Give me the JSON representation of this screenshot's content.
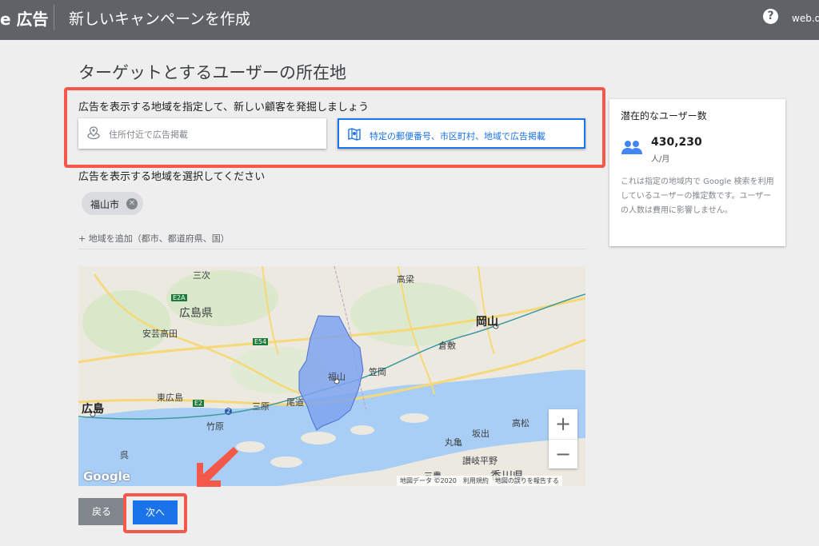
{
  "topbar": {
    "brand": "e 広告",
    "title": "新しいキャンペーンを作成",
    "help_icon": "?",
    "account": "web.de"
  },
  "page": {
    "heading": "ターゲットとするユーザーの所在地"
  },
  "location_type": {
    "label": "広告を表示する地域を指定して、新しい顧客を発掘しましょう",
    "options": [
      {
        "label": "住所付近で広告掲載",
        "icon": "location-radius-icon",
        "selected": false
      },
      {
        "label": "特定の郵便番号、市区町村、地域で広告掲載",
        "icon": "map-region-icon",
        "selected": true
      }
    ]
  },
  "region_select": {
    "label": "広告を表示する地域を選択してください",
    "chip": "福山市",
    "add_link": "+ 地域を追加（都市、都道府県、国）"
  },
  "audience": {
    "title": "潜在的なユーザー数",
    "count": "430,230",
    "unit": "人/月",
    "note": "これは指定の地域内で Google 検索を利用しているユーザーの推定数です。ユーザーの人数は費用に影響しません。"
  },
  "map": {
    "labels": {
      "miyoshi": "三次",
      "hiroshima_pref": "広島県",
      "akitakata": "安芸高田",
      "takahashi": "高梁",
      "okayama": "岡山",
      "kurashiki": "倉敷",
      "fukuyama": "福山",
      "kasaoka": "笠岡",
      "higashihiroshima": "東広島",
      "mihara": "三原",
      "onomichi": "尾道",
      "hiroshima": "広島",
      "takehara": "竹原",
      "kure": "呉",
      "marugame": "丸亀",
      "sakaide": "坂出",
      "takamatsu": "高松",
      "sanuki_plain": "讃岐平野",
      "kagawa": "香川県",
      "mitoyo": "三豊"
    },
    "roads": {
      "e2a": "E2A",
      "e54": "E54",
      "e2": "E2",
      "r2": "2"
    },
    "zoom_in": "+",
    "zoom_out": "−",
    "google": "Google",
    "attribution": "地図データ ©2020　利用規約　地図の誤りを報告する"
  },
  "actions": {
    "back": "戻る",
    "next": "次へ"
  },
  "colors": {
    "highlight": "#f4584a",
    "primary": "#1a73e8",
    "topbar": "#5f6368",
    "region_fill": "#7fa3ef"
  }
}
